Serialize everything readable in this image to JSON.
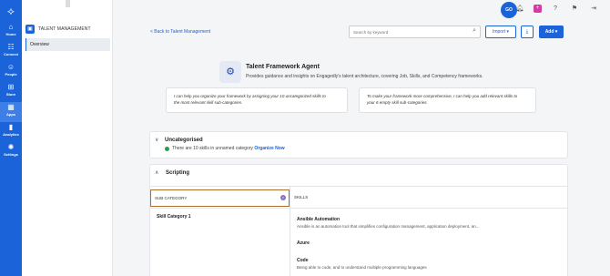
{
  "rail": {
    "items": [
      {
        "label": "Home",
        "icon": "home-icon",
        "glyph": "⌂"
      },
      {
        "label": "Connect",
        "icon": "connect-icon",
        "glyph": "☷"
      },
      {
        "label": "People",
        "icon": "people-icon",
        "glyph": "☺"
      },
      {
        "label": "Store",
        "icon": "store-icon",
        "glyph": "⊞"
      },
      {
        "label": "Apps",
        "icon": "apps-icon",
        "glyph": "▦"
      },
      {
        "label": "Analytics",
        "icon": "analytics-icon",
        "glyph": "▮"
      },
      {
        "label": "Settings",
        "icon": "settings-icon",
        "glyph": "✺"
      }
    ],
    "active": "Apps"
  },
  "sidebar": {
    "title": "TALENT MANAGEMENT",
    "items": [
      {
        "label": "Overview"
      }
    ]
  },
  "header": {
    "avatar_text": "GO",
    "icons": [
      "bell-icon",
      "plus-square-icon",
      "help-icon",
      "flag-icon",
      "exit-icon"
    ]
  },
  "toolbar": {
    "back_label": "< Back to Talent Management",
    "search_placeholder": "Search by keyword",
    "import_label": "Import ▾",
    "add_label": "Add ▾"
  },
  "agent": {
    "title": "Talent Framework Agent",
    "description": "Provides guidance and insights on Engagedly's talent architecture, covering Job, Skills, and Competency frameworks.",
    "suggestions": [
      {
        "line1": "I can help you organize your framework by assigning your 10 uncategorized skills to",
        "line2": "the most relevant skill sub-categories."
      },
      {
        "line1": "To make your framework more comprehensive, I can help you add relevant skills to",
        "line2": "your 6 empty skill sub-categories."
      }
    ]
  },
  "uncategorised": {
    "title": "Uncategorised",
    "text": "There are  10 skills in unnamed category",
    "link": "Organize Now"
  },
  "scripting": {
    "title": "Scripting",
    "col_subcategory": "SUB CATEGORY",
    "col_skills": "SKILLS",
    "category": "Skill Category 1",
    "skills": [
      {
        "name": "Ansible Automation",
        "desc": "Ansible is an automation tool that simplifies configuration management, application deployment, an..."
      },
      {
        "name": "Azure",
        "desc": ""
      },
      {
        "name": "Code",
        "desc": "Being able to code, and to understand multiple programming languages"
      }
    ]
  },
  "colors": {
    "primary": "#1b63d8",
    "highlight_border": "#b06f28",
    "status_green": "#2e9b46"
  }
}
